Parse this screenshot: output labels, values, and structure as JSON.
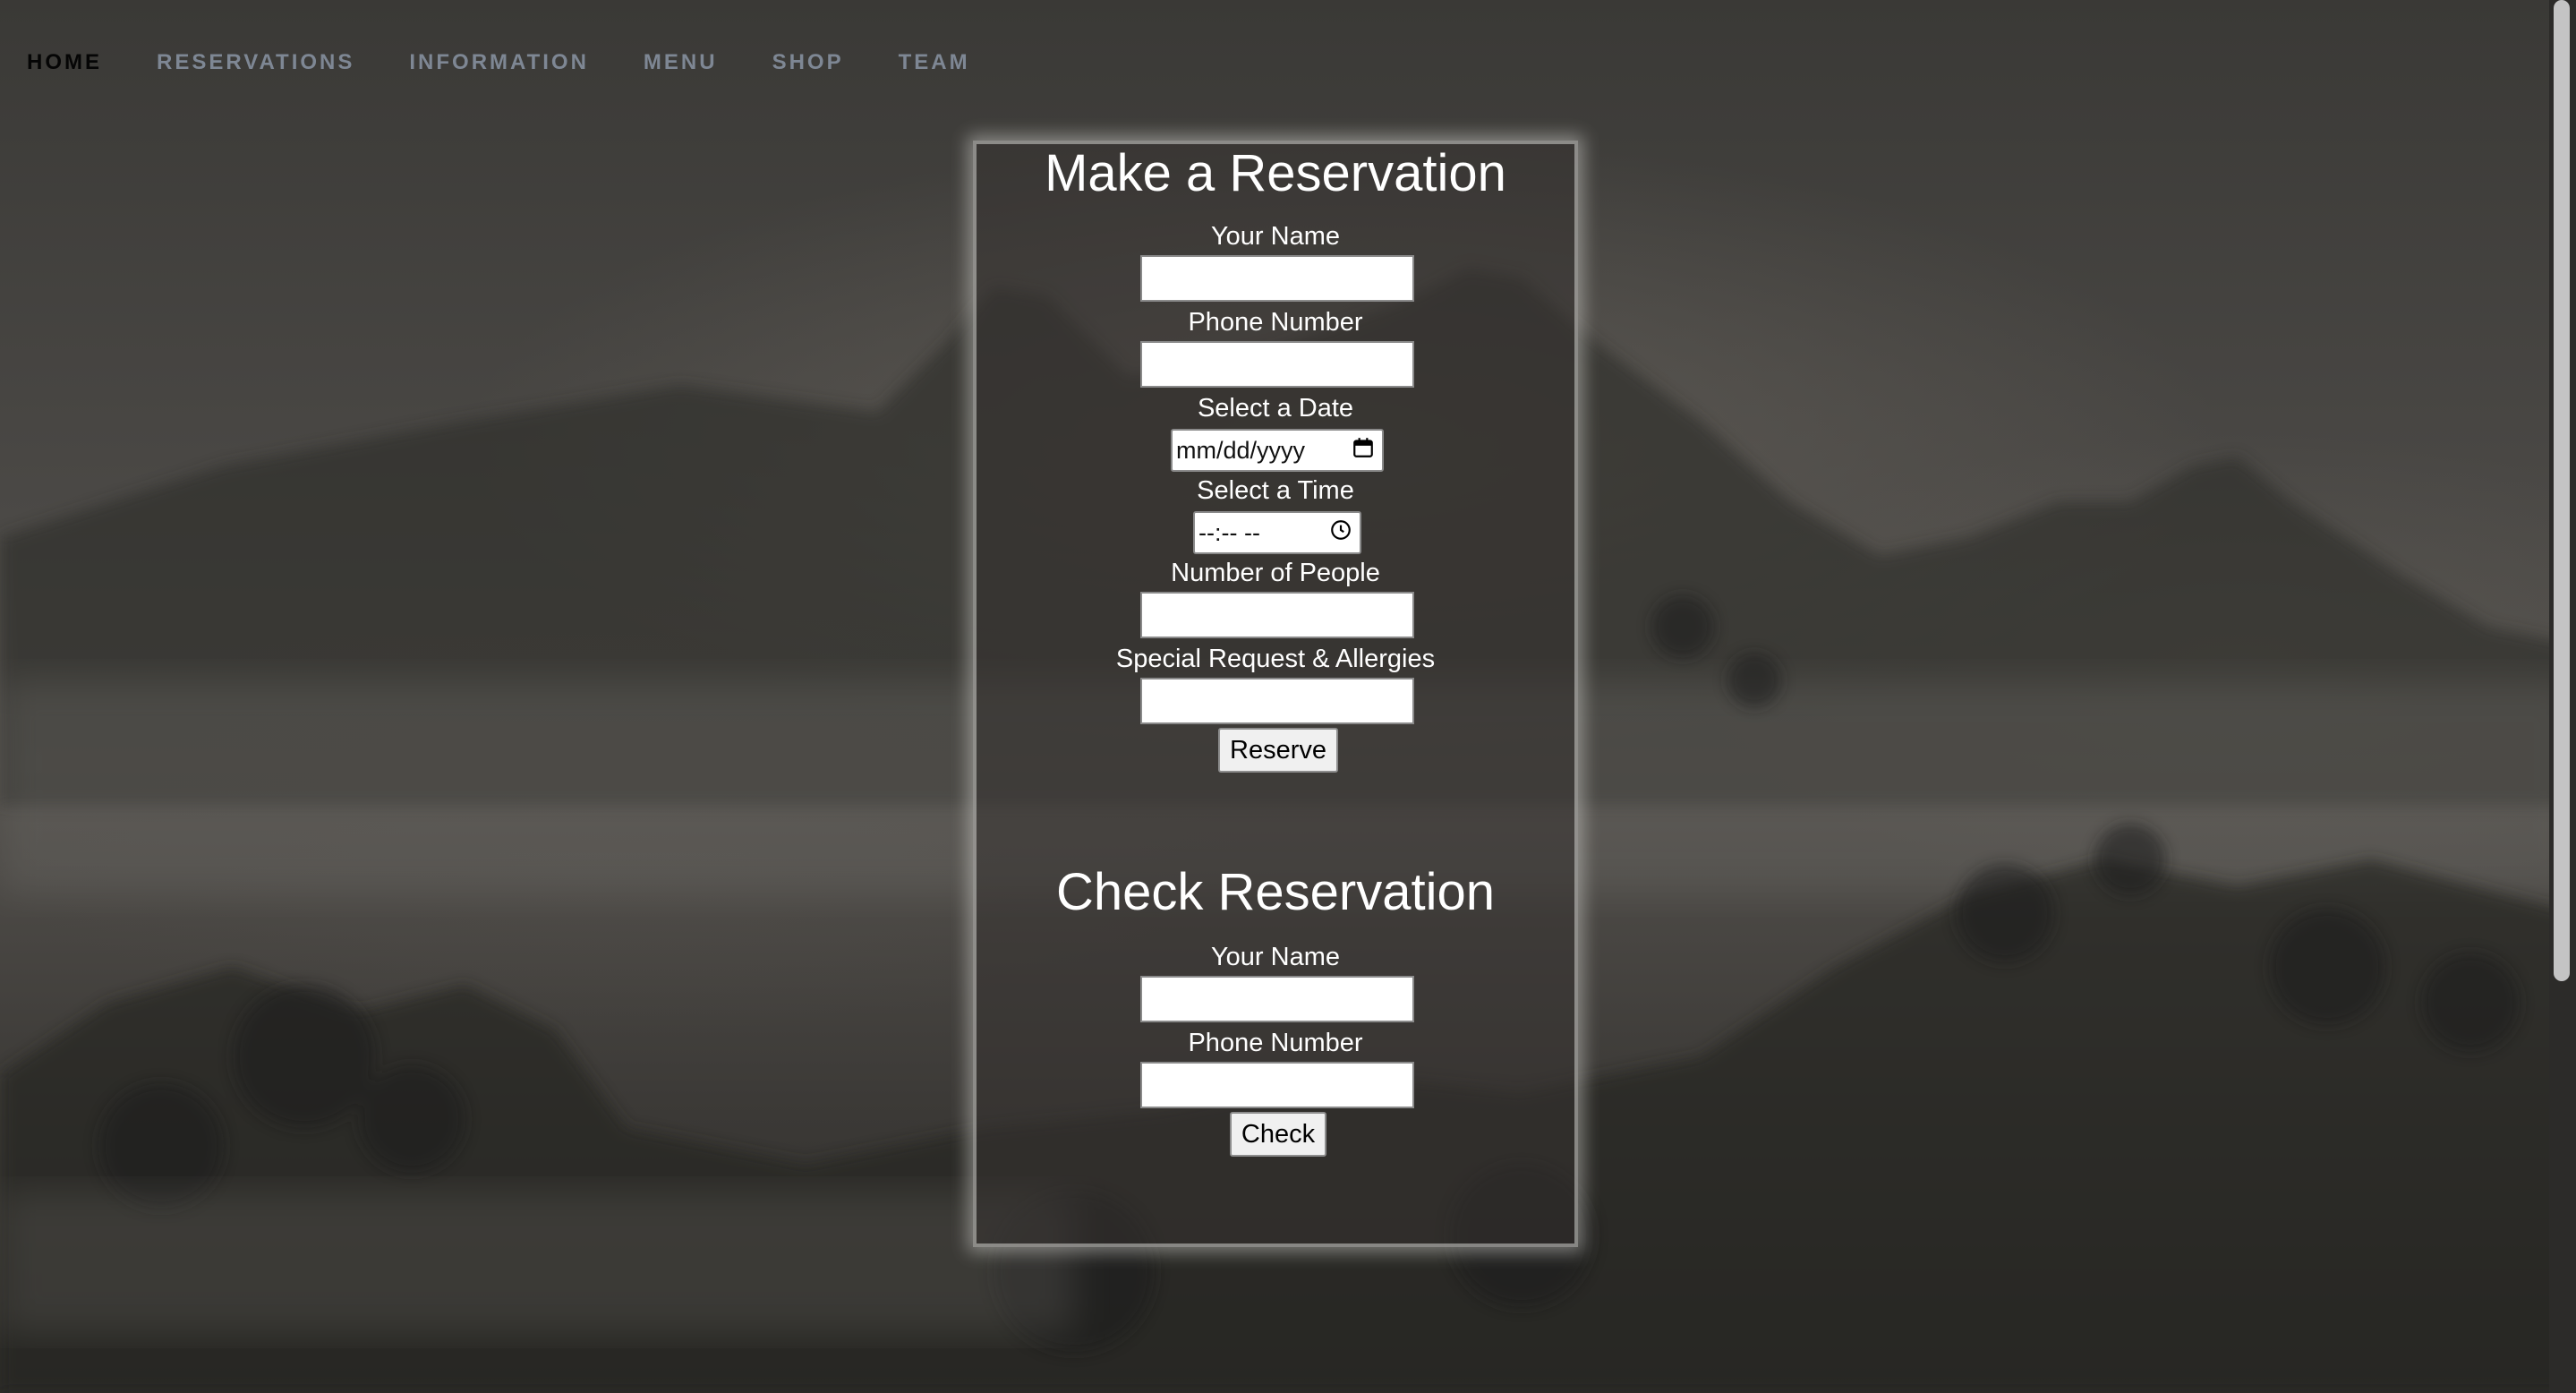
{
  "nav": {
    "items": [
      {
        "label": "HOME",
        "active": true
      },
      {
        "label": "RESERVATIONS",
        "active": false
      },
      {
        "label": "INFORMATION",
        "active": false
      },
      {
        "label": "MENU",
        "active": false
      },
      {
        "label": "SHOP",
        "active": false
      },
      {
        "label": "TEAM",
        "active": false
      }
    ]
  },
  "make_reservation": {
    "title": "Make a Reservation",
    "name_label": "Your Name",
    "name_value": "",
    "phone_label": "Phone Number",
    "phone_value": "",
    "date_label": "Select a Date",
    "date_value": "mm/dd/yyyy",
    "time_label": "Select a Time",
    "time_value": "--:-- --",
    "people_label": "Number of People",
    "people_value": "",
    "requests_label": "Special Request & Allergies",
    "requests_value": "",
    "submit_label": "Reserve"
  },
  "check_reservation": {
    "title": "Check Reservation",
    "name_label": "Your Name",
    "name_value": "",
    "phone_label": "Phone Number",
    "phone_value": "",
    "submit_label": "Check"
  },
  "icons": {
    "date": "calendar-icon",
    "time": "clock-icon"
  },
  "colors": {
    "nav_active": "#050505",
    "nav_inactive": "#7e8794",
    "text": "#ffffff"
  }
}
